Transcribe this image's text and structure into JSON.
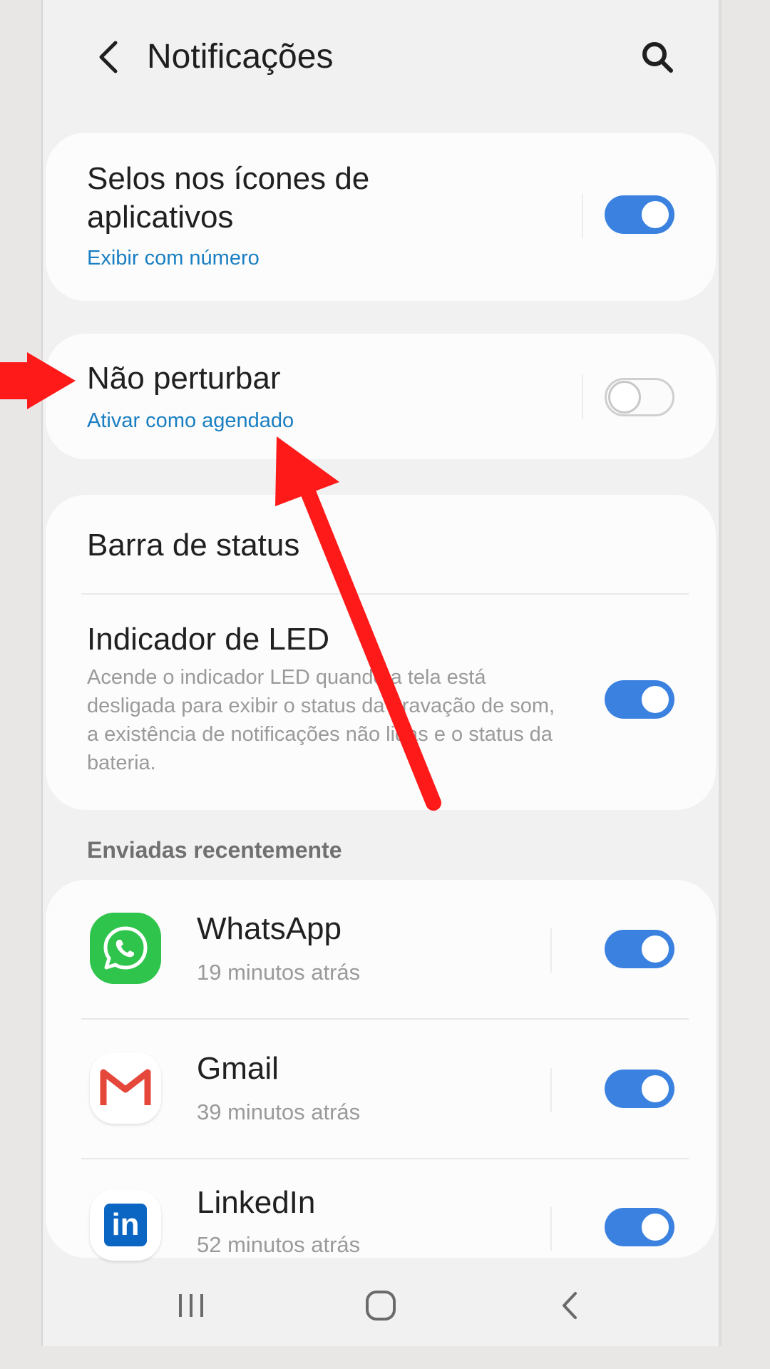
{
  "header": {
    "title": "Notificações"
  },
  "settings": {
    "badges": {
      "title": "Selos nos ícones de aplicativos",
      "subtitle": "Exibir com número",
      "enabled": true
    },
    "dnd": {
      "title": "Não perturbar",
      "subtitle": "Ativar como agendado",
      "enabled": false
    },
    "status_bar": {
      "title": "Barra de status"
    },
    "led": {
      "title": "Indicador de LED",
      "description": "Acende o indicador LED quando a tela está desligada para exibir o status da gravação de som, a existência de notificações não lidas e o status da bateria.",
      "enabled": true
    }
  },
  "recent": {
    "label": "Enviadas recentemente",
    "apps": [
      {
        "name": "WhatsApp",
        "time": "19 minutos atrás",
        "icon": "whatsapp-icon",
        "color": "#2fc44c",
        "enabled": true
      },
      {
        "name": "Gmail",
        "time": "39 minutos atrás",
        "icon": "gmail-icon",
        "color": "#e5473b",
        "enabled": true
      },
      {
        "name": "LinkedIn",
        "time": "52 minutos atrás",
        "icon": "linkedin-icon",
        "color": "#0a66c2",
        "enabled": true
      }
    ]
  },
  "navbar": {
    "icons": [
      "recent-apps-icon",
      "home-icon",
      "back-icon"
    ]
  },
  "colors": {
    "accent": "#3b82e0",
    "link": "#1a7fc2",
    "annotation": "#ff1a1a"
  }
}
